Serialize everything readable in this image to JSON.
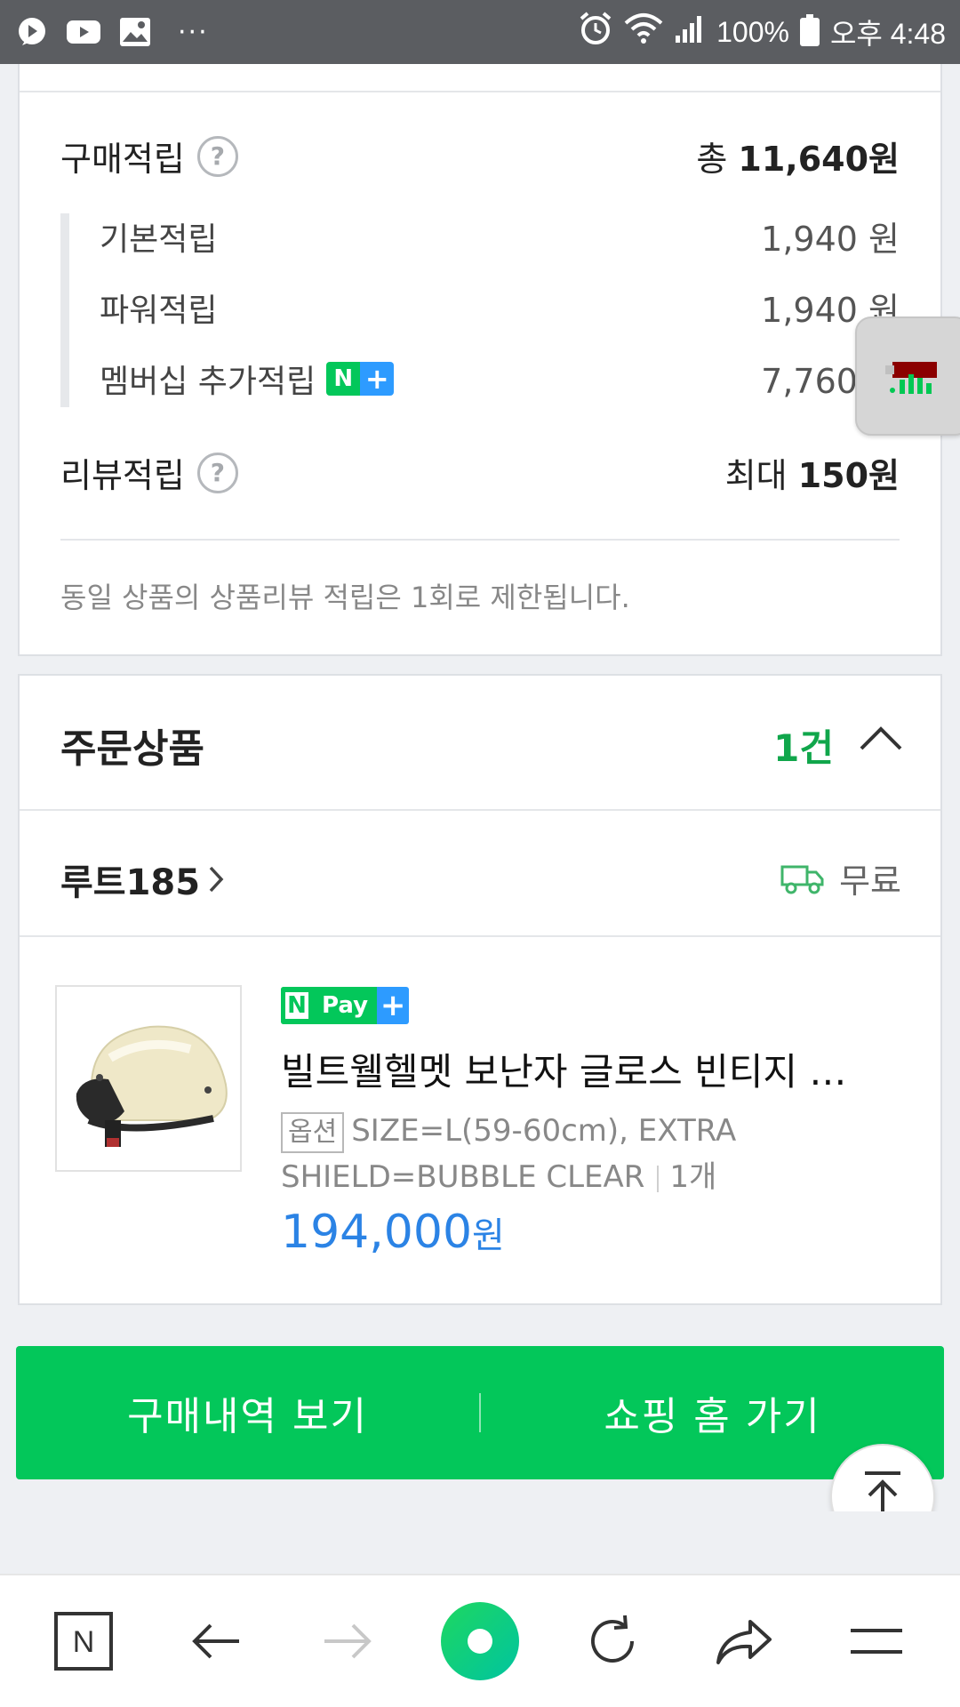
{
  "status_bar": {
    "battery": "100%",
    "time": "오후 4:48",
    "icons": [
      "play-icon",
      "youtube-icon",
      "gallery-icon",
      "more-dots-icon",
      "alarm-icon",
      "wifi-icon",
      "signal-icon",
      "battery-icon"
    ]
  },
  "points": {
    "purchase_label": "구매적립",
    "purchase_total_prefix": "총 ",
    "purchase_total": "11,640원",
    "items": [
      {
        "label": "기본적립",
        "value": "1,940 원"
      },
      {
        "label": "파워적립",
        "value": "1,940 원"
      },
      {
        "label": "멤버십 추가적립",
        "value": "7,760 원"
      }
    ],
    "membership_badge": {
      "n": "N",
      "plus": "+"
    },
    "review_label": "리뷰적립",
    "review_value_prefix": "최대 ",
    "review_value": "150원",
    "notice": "동일 상품의 상품리뷰 적립은 1회로 제한됩니다.",
    "help_glyph": "?"
  },
  "order": {
    "title": "주문상품",
    "count": "1건",
    "seller": "루트185",
    "shipping": "무료",
    "product": {
      "badge_n": "N",
      "badge_pay": "Pay",
      "badge_plus": "+",
      "name": "빌트웰헬멧 보난자 글로스 빈티지 …",
      "option_tag": "옵션",
      "option_text": "SIZE=L(59-60cm), EXTRA SHIELD=BUBBLE CLEAR",
      "quantity": "1개",
      "price": "194,000",
      "price_unit": "원"
    }
  },
  "actions": {
    "history_button": "구매내역 보기",
    "home_button": "쇼핑 홈 가기"
  },
  "bottom_nav": {
    "home_label": "N"
  },
  "colors": {
    "naver_green": "#03c75a",
    "count_green": "#10a64b",
    "price_blue": "#2b83e5",
    "plus_blue": "#2d9bff"
  }
}
